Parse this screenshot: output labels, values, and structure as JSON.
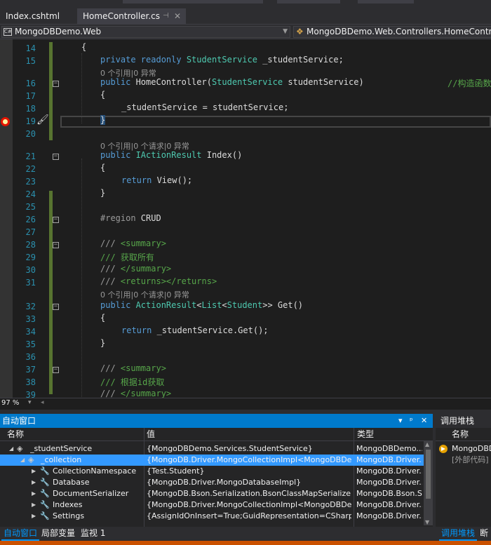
{
  "tabs": [
    {
      "label": "Index.cshtml",
      "active": false
    },
    {
      "label": "HomeController.cs",
      "active": true,
      "pin_icon": "pin-icon",
      "close_icon": "close-icon"
    }
  ],
  "navbar": {
    "project": "MongoDBDemo.Web",
    "project_icon": "cs-project-icon",
    "class_path": "MongoDBDemo.Web.Controllers.HomeControlle",
    "class_icon": "class-icon"
  },
  "editor": {
    "zoom": "97 %",
    "lines": [
      {
        "n": "14",
        "code": "{"
      },
      {
        "n": "15",
        "code": "private readonly StudentService _studentService;"
      },
      {
        "n": "16",
        "code": "public HomeController(StudentService studentService)",
        "comment": "//构造函数"
      },
      {
        "n": "17",
        "code": "{"
      },
      {
        "n": "18",
        "code": "_studentService = studentService;"
      },
      {
        "n": "19",
        "code": "}"
      },
      {
        "n": "20",
        "code": ""
      },
      {
        "n": "21",
        "code": "public IActionResult Index()"
      },
      {
        "n": "22",
        "code": "{"
      },
      {
        "n": "23",
        "code": "return View();"
      },
      {
        "n": "24",
        "code": "}"
      },
      {
        "n": "25",
        "code": ""
      },
      {
        "n": "26",
        "code": "#region CRUD"
      },
      {
        "n": "27",
        "code": ""
      },
      {
        "n": "28",
        "code": "/// <summary>"
      },
      {
        "n": "29",
        "code": "/// 获取所有"
      },
      {
        "n": "30",
        "code": "/// </summary>"
      },
      {
        "n": "31",
        "code": "/// <returns></returns>"
      },
      {
        "n": "32",
        "code": "public ActionResult<List<Student>> Get()"
      },
      {
        "n": "33",
        "code": "{"
      },
      {
        "n": "34",
        "code": "return _studentService.Get();"
      },
      {
        "n": "35",
        "code": "}"
      },
      {
        "n": "36",
        "code": ""
      },
      {
        "n": "37",
        "code": "/// <summary>"
      },
      {
        "n": "38",
        "code": "/// 根据id获取"
      },
      {
        "n": "39",
        "code": "/// </summary>"
      }
    ],
    "codelens": {
      "ctor": "0 个引用|0 异常",
      "index": "0 个引用|0 个请求|0 异常",
      "get": "0 个引用|0 个请求|0 异常"
    }
  },
  "autos": {
    "title": "自动窗口",
    "controls": {
      "dropdown": "▾",
      "pin": "ᵖ",
      "close": "✕"
    },
    "columns": {
      "name": "名称",
      "value": "值",
      "type": "类型"
    },
    "rows": [
      {
        "name": "_studentService",
        "value": "{MongoDBDemo.Services.StudentService}",
        "type": "MongoDBDemo....",
        "expanded": true,
        "icon": "field-icon"
      },
      {
        "name": "_collection",
        "value": "{MongoDB.Driver.MongoCollectionImpl<MongoDBDem...",
        "type": "MongoDB.Driver....",
        "expanded": true,
        "icon": "field-icon",
        "selected": true
      },
      {
        "name": "CollectionNamespace",
        "value": "{Test.Student}",
        "type": "MongoDB.Driver....",
        "icon": "wrench-icon"
      },
      {
        "name": "Database",
        "value": "{MongoDB.Driver.MongoDatabaseImpl}",
        "type": "MongoDB.Driver....",
        "icon": "wrench-icon"
      },
      {
        "name": "DocumentSerializer",
        "value": "{MongoDB.Bson.Serialization.BsonClassMapSerializer<M...",
        "type": "MongoDB.Bson.S...",
        "icon": "wrench-icon"
      },
      {
        "name": "Indexes",
        "value": "{MongoDB.Driver.MongoCollectionImpl<MongoDBDem...",
        "type": "MongoDB.Driver....",
        "icon": "wrench-icon"
      },
      {
        "name": "Settings",
        "value": "{AssignIdOnInsert=True;GuidRepresentation=CSharpLega...",
        "type": "MongoDB.Driver....",
        "icon": "wrench-icon"
      }
    ],
    "tabs": [
      "自动窗口",
      "局部变量",
      "监视 1"
    ]
  },
  "callstack": {
    "title": "调用堆栈",
    "column": "名称",
    "rows": [
      "MongoDBD",
      "[外部代码]"
    ],
    "tabs": [
      "调用堆栈",
      "断"
    ]
  }
}
